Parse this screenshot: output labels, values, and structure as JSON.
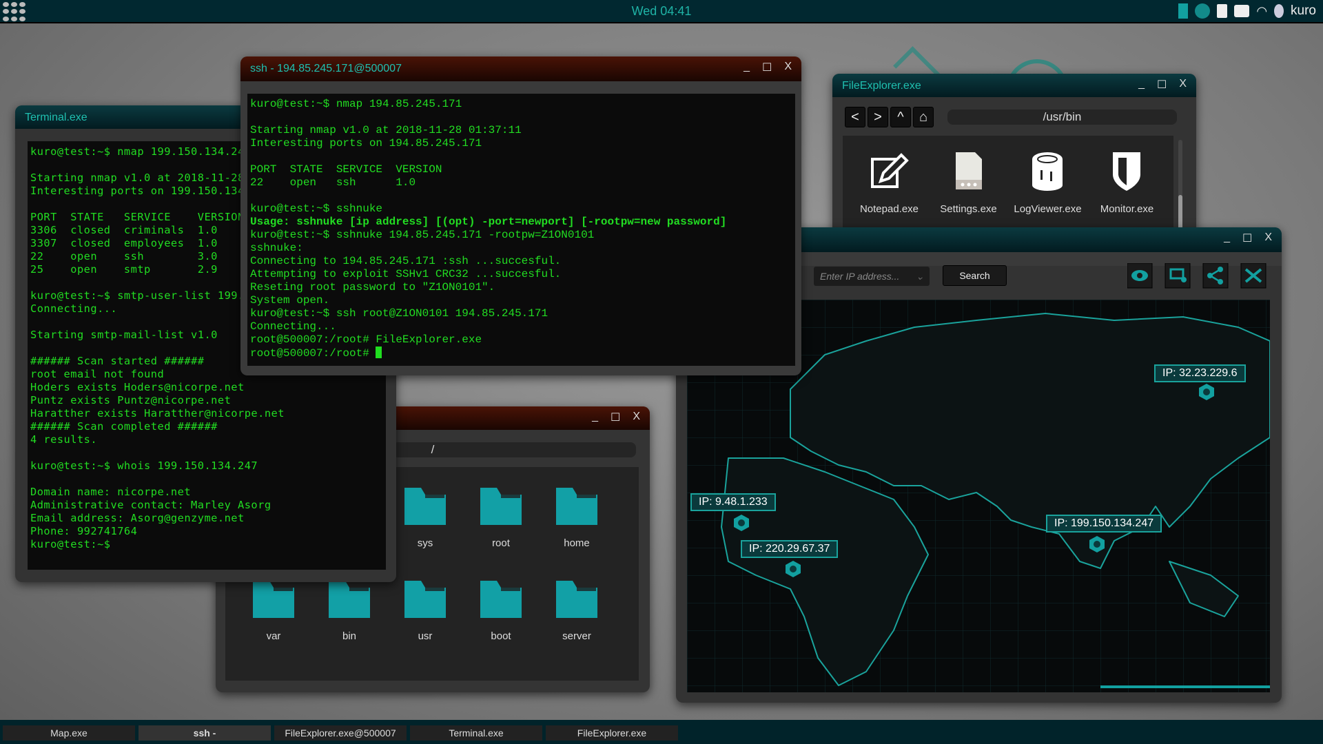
{
  "topbar": {
    "clock": "Wed 04:41",
    "user": "kuro",
    "icons": [
      "apps-grid-icon",
      "battery-icon",
      "globe-icon",
      "clipboard-icon",
      "chat-icon",
      "wifi-icon",
      "user-icon"
    ]
  },
  "terminal": {
    "title": "Terminal.exe",
    "lines": [
      "kuro@test:~$ nmap 199.150.134.247",
      "",
      "Starting nmap v1.0 at 2018-11-28 01:37:11",
      "Interesting ports on 199.150.134.247",
      "",
      "PORT  STATE   SERVICE    VERSION",
      "3306  closed  criminals  1.0",
      "3307  closed  employees  1.0",
      "22    open    ssh        3.0",
      "25    open    smtp       2.9",
      "",
      "kuro@test:~$ smtp-user-list 199.150.134.247",
      "Connecting...",
      "",
      "Starting smtp-mail-list v1.0",
      "",
      "###### Scan started ######",
      "root email not found",
      "Hoders exists Hoders@nicorpe.net",
      "Puntz exists Puntz@nicorpe.net",
      "Haratther exists Haratther@nicorpe.net",
      "###### Scan completed ######",
      "4 results.",
      "",
      "kuro@test:~$ whois 199.150.134.247",
      "",
      "Domain name: nicorpe.net",
      "Administrative contact: Marley Asorg",
      "Email address: Asorg@genzyme.net",
      "Phone: 992741764",
      "kuro@test:~$"
    ]
  },
  "ssh": {
    "title": "ssh - 194.85.245.171@500007",
    "lines": [
      "kuro@test:~$ nmap 194.85.245.171",
      "",
      "Starting nmap v1.0 at 2018-11-28 01:37:11",
      "Interesting ports on 194.85.245.171",
      "",
      "PORT  STATE  SERVICE  VERSION",
      "22    open   ssh      1.0",
      "",
      "kuro@test:~$ sshnuke"
    ],
    "usage": "Usage: sshnuke [ip address] [(opt) -port=newport] [-rootpw=new password]",
    "lines2": [
      "kuro@test:~$ sshnuke 194.85.245.171 -rootpw=Z1ON0101",
      "sshnuke:",
      "Connecting to 194.85.245.171 :ssh ...succesful.",
      "Attempting to exploit SSHv1 CRC32 ...succesful.",
      "Reseting root password to \"Z1ON0101\".",
      "System open.",
      "kuro@test:~$ ssh root@Z1ON0101 194.85.245.171",
      "Connecting...",
      "root@500007:/root# FileExplorer.exe"
    ],
    "prompt": "root@500007:/root# "
  },
  "fileexplorer_remote": {
    "path": "/",
    "folders": [
      "sys",
      "root",
      "home",
      "var",
      "bin",
      "usr",
      "boot",
      "server"
    ]
  },
  "fileexplorer": {
    "title": "FileExplorer.exe",
    "path": "/usr/bin",
    "files": [
      {
        "name": "Notepad.exe",
        "icon": "notepad-icon"
      },
      {
        "name": "Settings.exe",
        "icon": "settings-file-icon"
      },
      {
        "name": "LogViewer.exe",
        "icon": "log-icon"
      },
      {
        "name": "Monitor.exe",
        "icon": "shield-icon"
      }
    ]
  },
  "map": {
    "ip_placeholder": "Enter IP address...",
    "search": "Search",
    "tools": [
      "eye-icon",
      "add-monitor-icon",
      "share-icon",
      "shuffle-icon"
    ],
    "nodes": [
      "IP: 32.23.229.6",
      "IP: 9.48.1.233",
      "IP: 220.29.67.37",
      "IP: 199.150.134.247"
    ]
  },
  "taskbar": [
    "Map.exe",
    "ssh -",
    "FileExplorer.exe@500007",
    "Terminal.exe",
    "FileExplorer.exe"
  ],
  "colors": {
    "accent": "#1fc0b0",
    "terminal_text": "#22dd22",
    "folder": "#12a0a6",
    "topbar": "#012830"
  }
}
